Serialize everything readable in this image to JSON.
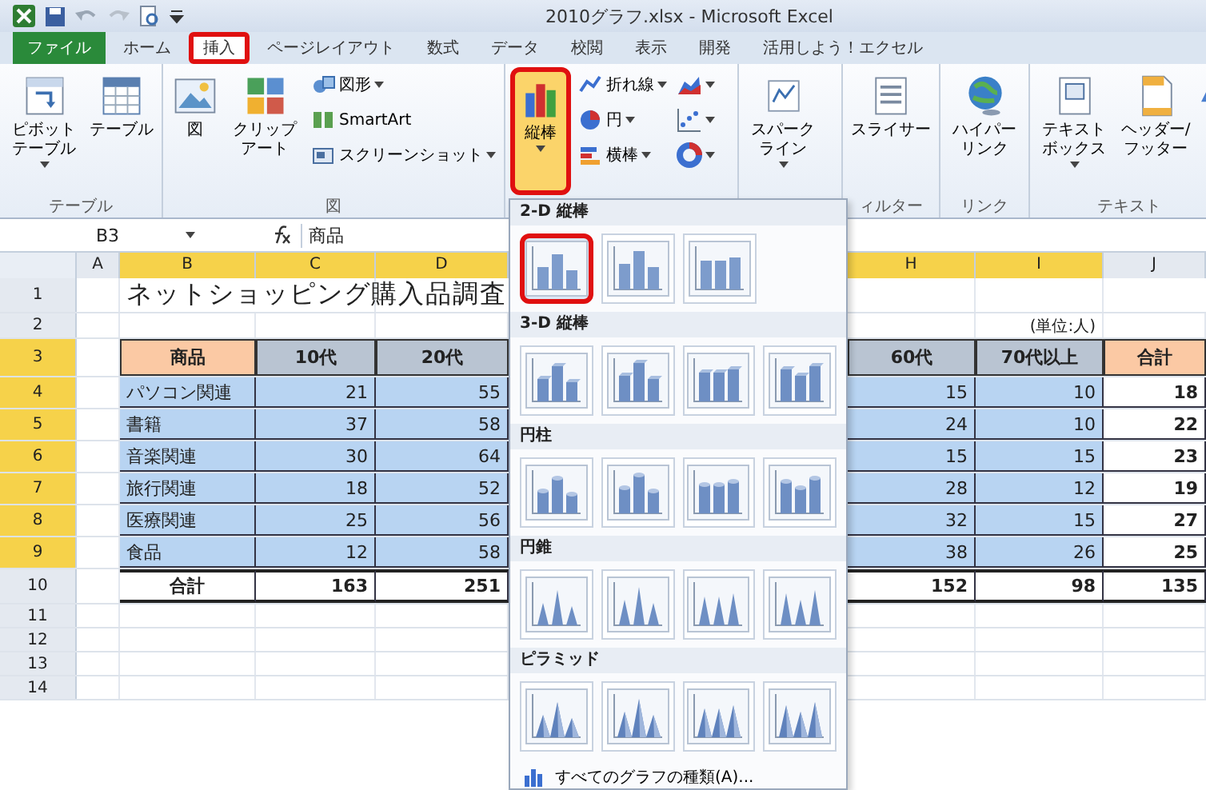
{
  "window": {
    "title": "2010グラフ.xlsx - Microsoft Excel"
  },
  "tabs": [
    {
      "label": "ファイル",
      "kind": "file",
      "selected": false
    },
    {
      "label": "ホーム",
      "kind": "tab",
      "selected": false
    },
    {
      "label": "挿入",
      "kind": "tab",
      "selected": true
    },
    {
      "label": "ページレイアウト",
      "kind": "tab",
      "selected": false
    },
    {
      "label": "数式",
      "kind": "tab",
      "selected": false
    },
    {
      "label": "データ",
      "kind": "tab",
      "selected": false
    },
    {
      "label": "校閲",
      "kind": "tab",
      "selected": false
    },
    {
      "label": "表示",
      "kind": "tab",
      "selected": false
    },
    {
      "label": "開発",
      "kind": "tab",
      "selected": false
    },
    {
      "label": "活用しよう！エクセル",
      "kind": "tab",
      "selected": false
    }
  ],
  "ribbon": {
    "groups": [
      {
        "label": "テーブル",
        "items": [
          {
            "kind": "pivot",
            "label": "ピボットテーブル",
            "dropdown": true,
            "pressed": false
          },
          {
            "kind": "table",
            "label": "テーブル",
            "pressed": false
          }
        ]
      },
      {
        "label": "図",
        "items": [
          {
            "kind": "picture",
            "label": "図",
            "pressed": false
          },
          {
            "kind": "clipart",
            "label": "クリップアート",
            "pressed": false
          },
          {
            "stack": [
              {
                "kind": "shapes",
                "label": "図形",
                "dropdown": true
              },
              {
                "kind": "smartart",
                "label": "SmartArt"
              },
              {
                "kind": "screenshot",
                "label": "スクリーンショット",
                "dropdown": true
              }
            ]
          }
        ]
      },
      {
        "items": [
          {
            "kind": "column",
            "label": "縦棒",
            "dropdown": true,
            "pressed": true
          },
          {
            "stack": [
              {
                "kind": "line",
                "label": "折れ線",
                "dropdown": true
              },
              {
                "kind": "pie",
                "label": "円",
                "dropdown": true
              },
              {
                "kind": "bar",
                "label": "横棒",
                "dropdown": true
              }
            ]
          },
          {
            "stack": [
              {
                "kind": "area",
                "dropdown": true
              },
              {
                "kind": "scatter",
                "dropdown": true
              },
              {
                "kind": "donut",
                "dropdown": true
              }
            ]
          }
        ]
      },
      {
        "items": [
          {
            "kind": "sparkline",
            "label": "スパークライン",
            "dropdown": true,
            "pressed": false
          }
        ]
      },
      {
        "label": "ィルター",
        "items": [
          {
            "kind": "slicer",
            "label": "スライサー",
            "pressed": false
          }
        ]
      },
      {
        "label": "リンク",
        "items": [
          {
            "kind": "hyperlink",
            "label": "ハイパーリンク",
            "pressed": false
          }
        ]
      },
      {
        "label": "テキスト",
        "items": [
          {
            "kind": "textbox",
            "label": "テキストボックス",
            "dropdown": true,
            "pressed": false
          },
          {
            "kind": "header",
            "label": "ヘッダー/フッター",
            "pressed": false
          },
          {
            "kind": "wordart",
            "pressed": false
          }
        ]
      }
    ]
  },
  "formula_bar": {
    "name_box": "B3",
    "formula": "商品"
  },
  "sheet": {
    "columns": [
      {
        "label": "A",
        "selected": false
      },
      {
        "label": "B",
        "selected": true
      },
      {
        "label": "C",
        "selected": true
      },
      {
        "label": "D",
        "selected": true
      },
      {
        "label": "H",
        "selected": true
      },
      {
        "label": "I",
        "selected": true
      },
      {
        "label": "J",
        "selected": false
      }
    ],
    "rows": [
      {
        "label": "1",
        "selected": false
      },
      {
        "label": "2",
        "selected": false
      },
      {
        "label": "3",
        "selected": true
      },
      {
        "label": "4",
        "selected": true
      },
      {
        "label": "5",
        "selected": true
      },
      {
        "label": "6",
        "selected": true
      },
      {
        "label": "7",
        "selected": true
      },
      {
        "label": "8",
        "selected": true
      },
      {
        "label": "9",
        "selected": true
      },
      {
        "label": "10",
        "selected": false
      },
      {
        "label": "11",
        "selected": false
      },
      {
        "label": "12",
        "selected": false
      },
      {
        "label": "13",
        "selected": false
      },
      {
        "label": "14",
        "selected": false
      }
    ],
    "title": "ネットショッピング購入品調査",
    "unit_note": "(単位:人)"
  },
  "table": {
    "columns": [
      "商品",
      "10代",
      "20代",
      "60代",
      "70代以上",
      "合計"
    ],
    "rows": [
      {
        "kind": "data",
        "cells": [
          "パソコン関連",
          "21",
          "55",
          "15",
          "10",
          "18"
        ]
      },
      {
        "kind": "data",
        "cells": [
          "書籍",
          "37",
          "58",
          "24",
          "10",
          "22"
        ]
      },
      {
        "kind": "data",
        "cells": [
          "音楽関連",
          "30",
          "64",
          "15",
          "15",
          "23"
        ]
      },
      {
        "kind": "data",
        "cells": [
          "旅行関連",
          "18",
          "52",
          "28",
          "12",
          "19"
        ]
      },
      {
        "kind": "data",
        "cells": [
          "医療関連",
          "25",
          "56",
          "32",
          "15",
          "27"
        ]
      },
      {
        "kind": "data",
        "cells": [
          "食品",
          "12",
          "58",
          "38",
          "26",
          "25"
        ]
      },
      {
        "kind": "total",
        "cells": [
          "合計",
          "163",
          "251",
          "152",
          "98",
          "135"
        ]
      }
    ]
  },
  "chart_menu": {
    "sections": [
      {
        "title": "2-D 縦棒",
        "kind": "column",
        "items": [
          {
            "selected": true
          },
          {
            "selected": false
          },
          {
            "selected": false
          }
        ]
      },
      {
        "title": "3-D 縦棒",
        "kind": "column3d",
        "items": [
          {
            "selected": false
          },
          {
            "selected": false
          },
          {
            "selected": false
          },
          {
            "selected": false
          }
        ]
      },
      {
        "title": "円柱",
        "kind": "cylinder",
        "items": [
          {
            "selected": false
          },
          {
            "selected": false
          },
          {
            "selected": false
          },
          {
            "selected": false
          }
        ]
      },
      {
        "title": "円錐",
        "kind": "cone",
        "items": [
          {
            "selected": false
          },
          {
            "selected": false
          },
          {
            "selected": false
          },
          {
            "selected": false
          }
        ]
      },
      {
        "title": "ピラミッド",
        "kind": "pyramid",
        "items": [
          {
            "selected": false
          },
          {
            "selected": false
          },
          {
            "selected": false
          },
          {
            "selected": false
          }
        ]
      }
    ],
    "footer": "すべてのグラフの種類(A)..."
  }
}
